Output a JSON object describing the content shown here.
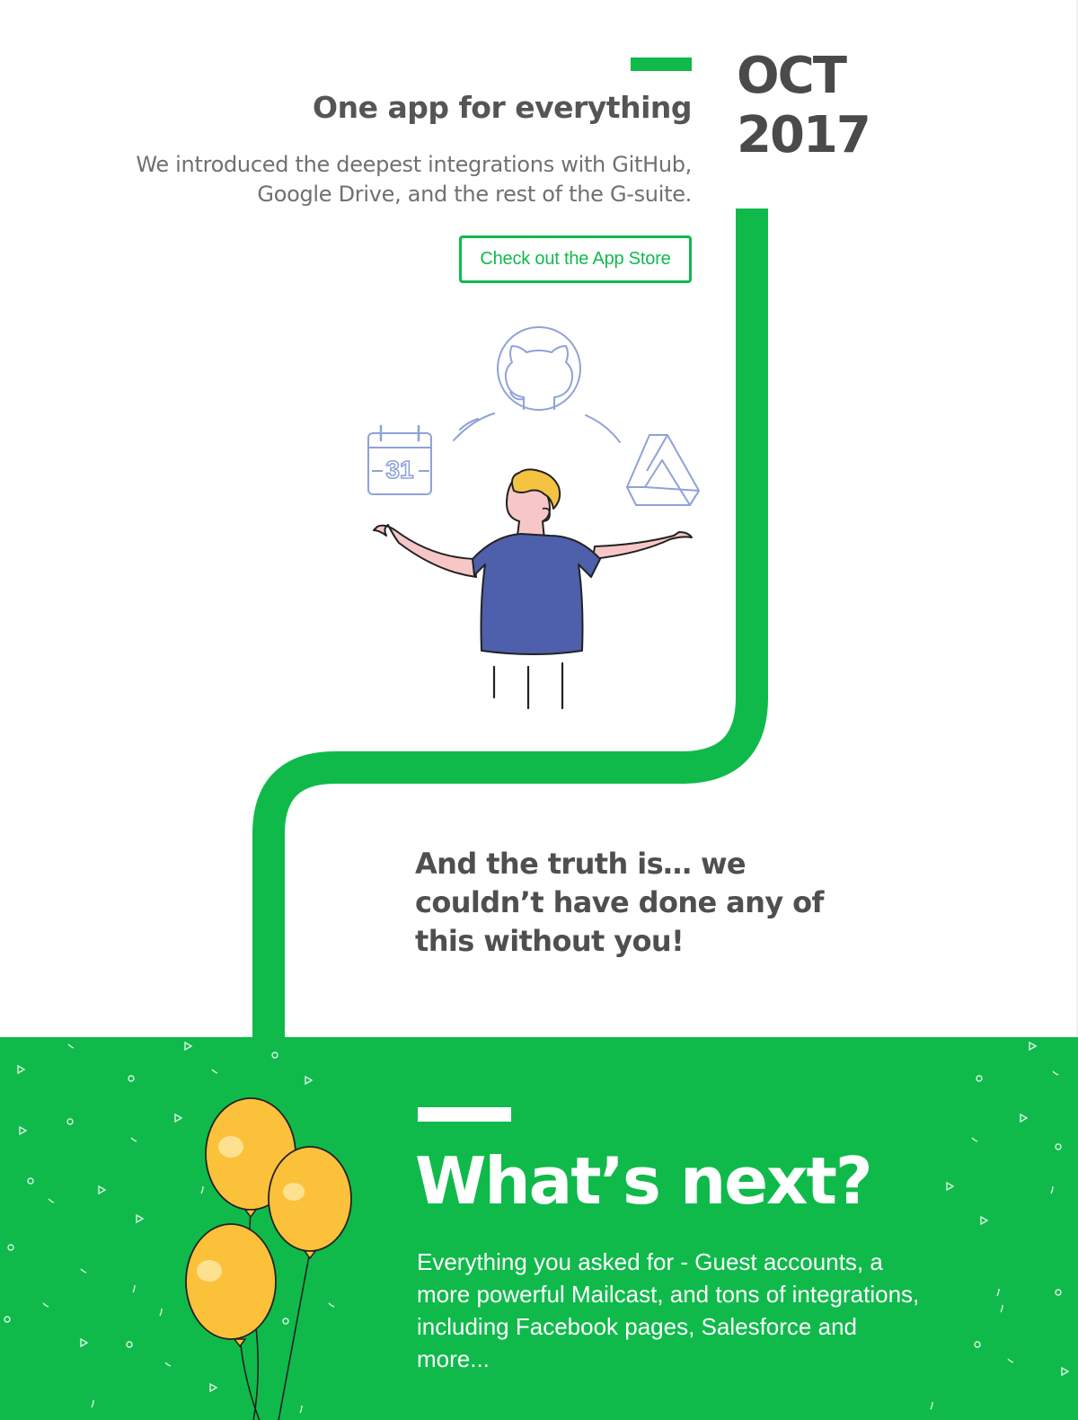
{
  "milestone": {
    "title": "One app for everything",
    "description": "We introduced the deepest integrations with GitHub, Google Drive, and the rest of the G-suite.",
    "cta_label": "Check out the App Store",
    "date_month": "OCT",
    "date_year": "2017",
    "illustration": {
      "calendar_day": "31",
      "icons": [
        "calendar-icon",
        "github-icon",
        "google-drive-icon"
      ]
    }
  },
  "truth": {
    "text": "And the truth is… we couldn’t have done any of this without you!"
  },
  "next": {
    "title": "What’s next?",
    "body": "Everything you asked for - Guest accounts, a more powerful Mailcast, and tons of integrations, including Facebook pages, Salesforce and more..."
  },
  "colors": {
    "brand_green": "#0fba4b",
    "heading_gray": "#555555",
    "body_gray": "#707070",
    "balloon_yellow": "#fcc13a",
    "shirt_blue": "#4e5fab",
    "icon_blue": "#8fa2d8"
  }
}
